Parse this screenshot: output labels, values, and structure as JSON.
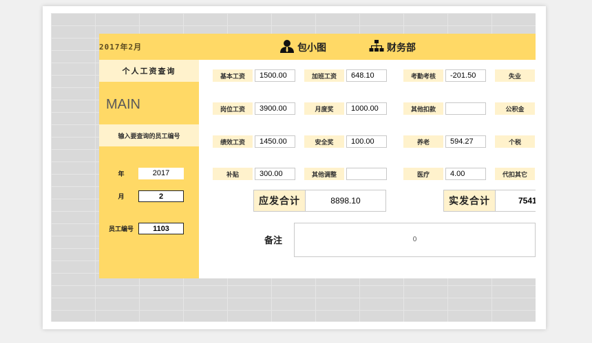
{
  "header": {
    "year_month": "2017年2月",
    "user_name": "包小图",
    "department": "财务部"
  },
  "sidebar": {
    "title": "个人工资查询",
    "main_label": "MAIN",
    "hint": "输入要查询的员工编号",
    "year_label": "年",
    "year_value": "2017",
    "month_label": "月",
    "month_value": "2",
    "employee_id_label": "员工编号",
    "employee_id_value": "1103"
  },
  "fields": {
    "col1": [
      {
        "label": "基本工资",
        "value": "1500.00"
      },
      {
        "label": "岗位工资",
        "value": "3900.00"
      },
      {
        "label": "绩效工资",
        "value": "1450.00"
      },
      {
        "label": "补贴",
        "value": "300.00"
      }
    ],
    "col2": [
      {
        "label": "加班工资",
        "value": "648.10"
      },
      {
        "label": "月度奖",
        "value": "1000.00"
      },
      {
        "label": "安全奖",
        "value": "100.00"
      },
      {
        "label": "其他调整",
        "value": ""
      }
    ],
    "col3": [
      {
        "label": "考勤考核",
        "value": "-201.50"
      },
      {
        "label": "其他扣款",
        "value": ""
      },
      {
        "label": "养老",
        "value": "594.27"
      },
      {
        "label": "医疗",
        "value": "4.00"
      }
    ],
    "col4": [
      {
        "label": "失业"
      },
      {
        "label": "公积金"
      },
      {
        "label": "个税"
      },
      {
        "label": "代扣其它"
      }
    ]
  },
  "totals": {
    "gross_label": "应发合计",
    "gross_value": "8898.10",
    "net_label": "实发合计",
    "net_value": "7541"
  },
  "remark": {
    "label": "备注",
    "value": "0"
  }
}
